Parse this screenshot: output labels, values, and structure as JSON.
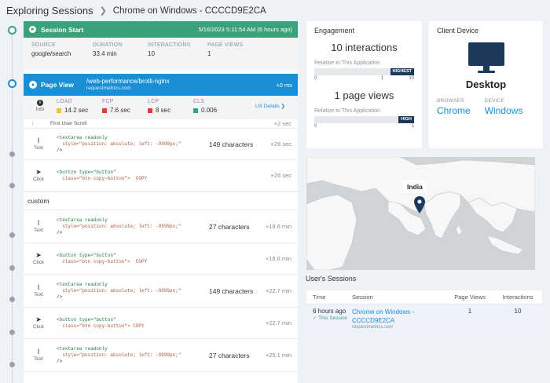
{
  "breadcrumb": {
    "root": "Exploring Sessions",
    "current": "Chrome on Windows - CCCCD9E2CA"
  },
  "session_start": {
    "title": "Session Start",
    "timestamp": "5/16/2023 5:11:54 AM (6 hours ago)",
    "fields": [
      {
        "label": "SOURCE",
        "value": "google/search"
      },
      {
        "label": "DURATION",
        "value": "33.4 min"
      },
      {
        "label": "INTERACTIONS",
        "value": "10"
      },
      {
        "label": "PAGE VIEWS",
        "value": "1"
      }
    ]
  },
  "page_view": {
    "title": "Page View",
    "path": "/web-performance/brotli-nginx",
    "host": "requestmetrics.com",
    "offset": "+0 ms",
    "info_label": "Info",
    "vitals": [
      {
        "label": "LOAD",
        "value": "14.2 sec",
        "color": "#f2c230"
      },
      {
        "label": "FCP",
        "value": "7.6 sec",
        "color": "#e0393e"
      },
      {
        "label": "LCP",
        "value": "8 sec",
        "color": "#e0393e"
      },
      {
        "label": "CLS",
        "value": "0.006",
        "color": "#3aa27a"
      }
    ],
    "ux_details": "UX Details"
  },
  "first_scroll": {
    "label": "First User Scroll",
    "time": "+2 sec"
  },
  "custom_label": "custom",
  "events": [
    {
      "kind": "Text",
      "c1": "<textarea readonly",
      "c2": "  style=\"position: absolute; left: -9999px;\"",
      "c3": "/>",
      "chars": "149 characters",
      "time": "+26 sec"
    },
    {
      "kind": "Click",
      "c1": "<button type=\"button\"",
      "c2": "  class=\"btn copy-button\">  COPY",
      "c3": "",
      "chars": "",
      "time": "+26 sec"
    },
    {
      "kind": "Text",
      "c1": "<textarea readonly",
      "c2": "  style=\"position: absolute; left: -9999px;\"",
      "c3": "/>",
      "chars": "27 characters",
      "time": "+18.6 min"
    },
    {
      "kind": "Click",
      "c1": "<button type=\"button\"",
      "c2": "  class=\"btn copy-button\">  COPY",
      "c3": "",
      "chars": "",
      "time": "+18.6 min"
    },
    {
      "kind": "Text",
      "c1": "<textarea readonly",
      "c2": "  style=\"position: absolute; left: -9999px;\"",
      "c3": "/>",
      "chars": "149 characters",
      "time": "+22.7 min"
    },
    {
      "kind": "Click",
      "c1": "<button type=\"button\"",
      "c2": "  class=\"btn copy-button\"> COPY",
      "c3": "",
      "chars": "",
      "time": "+22.7 min"
    },
    {
      "kind": "Text",
      "c1": "<textarea readonly",
      "c2": "  style=\"position: absolute; left: -9999px;\"",
      "c3": "/>",
      "chars": "27 characters",
      "time": "+25.1 min"
    }
  ],
  "engagement": {
    "title": "Engagement",
    "interactions": "10 interactions",
    "rel1": "Relative to This Application",
    "tag1": "HIGHEST",
    "scale1": [
      "0",
      "1",
      "10"
    ],
    "page_views": "1 page views",
    "rel2": "Relative to This Application",
    "tag2": "HIGH",
    "scale2": [
      "0",
      "1"
    ]
  },
  "client_device": {
    "title": "Client Device",
    "device": "Desktop",
    "browser_label": "BROWSER",
    "browser": "Chrome",
    "device_label": "DEVICE",
    "os": "Windows"
  },
  "map": {
    "location": "India"
  },
  "users_sessions": {
    "title": "User's Sessions",
    "headers": [
      "Time",
      "Session",
      "Page Views",
      "Interactions"
    ],
    "row": {
      "time": "6 hours ago",
      "this_session": "This Session",
      "session": "Chrome on Windows - CCCCD9E2CA",
      "host": "requestmetrics.com",
      "page_views": "1",
      "interactions": "10"
    }
  },
  "colors": {
    "accent": "#1a8fd6",
    "green": "#3aa27a",
    "navy": "#1b3a5b"
  }
}
